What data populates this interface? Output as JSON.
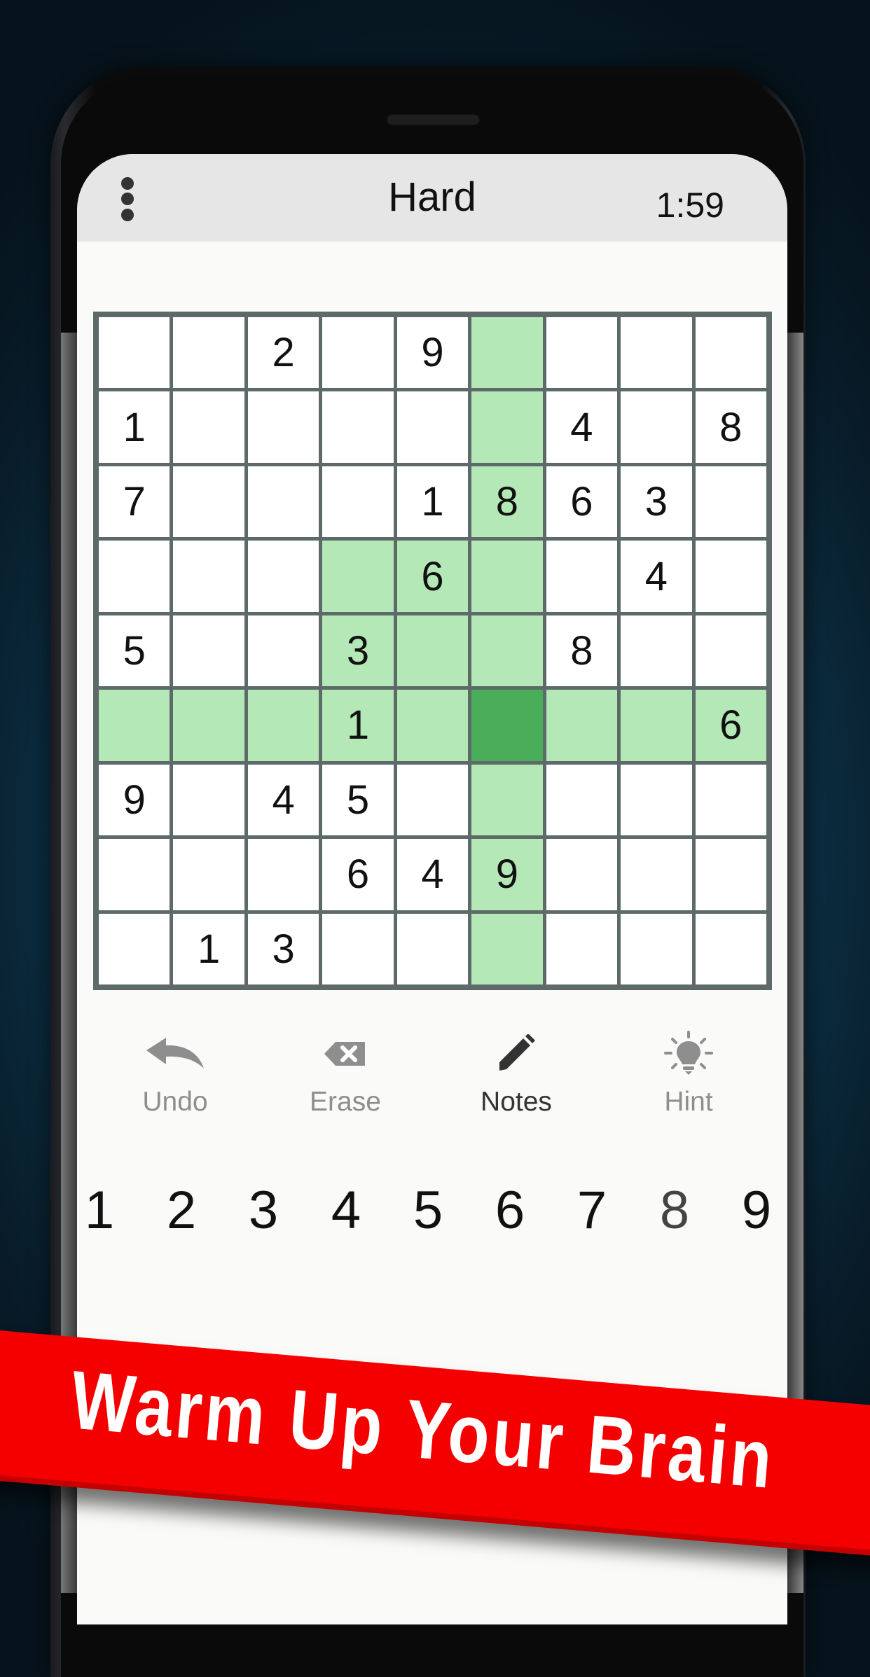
{
  "header": {
    "menu_icon": "more-vertical-icon",
    "difficulty": "Hard",
    "timer": "1:59"
  },
  "board": {
    "selected": {
      "row": 6,
      "col": 6
    },
    "highlight_color": "#b4e8b6",
    "selected_color": "#4aad5a",
    "rows": [
      [
        "",
        "",
        "2",
        "",
        "9",
        "",
        "",
        "",
        ""
      ],
      [
        "1",
        "",
        "",
        "",
        "",
        "",
        "4",
        "",
        "8"
      ],
      [
        "7",
        "",
        "",
        "",
        "1",
        "8",
        "6",
        "3",
        ""
      ],
      [
        "",
        "",
        "",
        "",
        "6",
        "",
        "",
        "4",
        ""
      ],
      [
        "5",
        "",
        "",
        "3",
        "",
        "",
        "8",
        "",
        ""
      ],
      [
        "",
        "",
        "",
        "1",
        "",
        "",
        "",
        "",
        "6"
      ],
      [
        "9",
        "",
        "4",
        "5",
        "",
        "",
        "",
        "",
        ""
      ],
      [
        "",
        "",
        "",
        "6",
        "4",
        "9",
        "",
        "",
        ""
      ],
      [
        "",
        "1",
        "3",
        "",
        "",
        "",
        "",
        "",
        ""
      ]
    ]
  },
  "tools": [
    {
      "label": "Undo",
      "icon": "undo-arrow-icon",
      "active": false
    },
    {
      "label": "Erase",
      "icon": "backspace-erase-icon",
      "active": false
    },
    {
      "label": "Notes",
      "icon": "pencil-icon",
      "active": true
    },
    {
      "label": "Hint",
      "icon": "lightbulb-icon",
      "active": false
    }
  ],
  "numpad": [
    "1",
    "2",
    "3",
    "4",
    "5",
    "6",
    "7",
    "8",
    "9"
  ],
  "banner": {
    "text": "Warm Up Your Brain",
    "color": "#f40000"
  }
}
